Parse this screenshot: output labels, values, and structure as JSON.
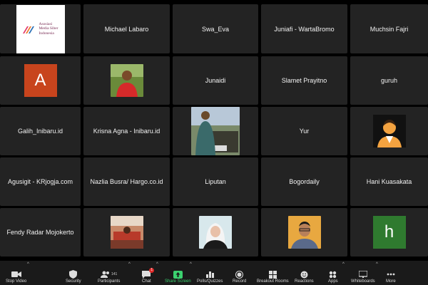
{
  "participants": [
    {
      "id": "logo",
      "logo_lines": [
        "Asosiasi",
        "Media Siber",
        "Indonesia"
      ]
    },
    {
      "id": "michael",
      "name": "Michael  Labaro"
    },
    {
      "id": "swa",
      "name": "Swa_Eva"
    },
    {
      "id": "juniafi",
      "name": "Juniafi - WartaBromo"
    },
    {
      "id": "muchsin",
      "name": "Muchsin Fajri"
    },
    {
      "id": "a",
      "letter": "A",
      "color": "#c8441d"
    },
    {
      "id": "photo1"
    },
    {
      "id": "junaidi",
      "name": "Junaidi"
    },
    {
      "id": "slamet",
      "name": "Slamet Prayitno"
    },
    {
      "id": "guruh",
      "name": "guruh"
    },
    {
      "id": "galih",
      "name": "Galih_Inibaru.id"
    },
    {
      "id": "krisna",
      "name": "Krisna Agna - Inibaru.id"
    },
    {
      "id": "photo2"
    },
    {
      "id": "yur",
      "name": "Yur"
    },
    {
      "id": "avatar-generic"
    },
    {
      "id": "agusigit",
      "name": "Agusigit - KRjogja.com"
    },
    {
      "id": "nazlia",
      "name": "Nazlia Busra/ Hargo.co.id"
    },
    {
      "id": "liputan",
      "name": "Liputan"
    },
    {
      "id": "bogor",
      "name": "Bogordaily"
    },
    {
      "id": "hani",
      "name": "Hani Kuasakata"
    },
    {
      "id": "fendy",
      "name": "Fendy Radar Mojokerto"
    },
    {
      "id": "photo3"
    },
    {
      "id": "photo4"
    },
    {
      "id": "photo5"
    },
    {
      "id": "h",
      "letter": "h",
      "color": "#2f7a2f"
    }
  ],
  "toolbar": {
    "stop_video": "Stop Video",
    "security": "Security",
    "participants": "Participants",
    "participants_count": "141",
    "chat": "Chat",
    "chat_badge": "1",
    "share_screen": "Share Screen",
    "polls": "Polls/Quizzes",
    "record": "Record",
    "breakout": "Breakout Rooms",
    "reactions": "Reactions",
    "apps": "Apps",
    "whiteboards": "Whiteboards",
    "more": "More"
  },
  "colors": {
    "share_green": "#3bd16f",
    "tile_bg": "#232323",
    "toolbar_bg": "#1a1a1a"
  }
}
